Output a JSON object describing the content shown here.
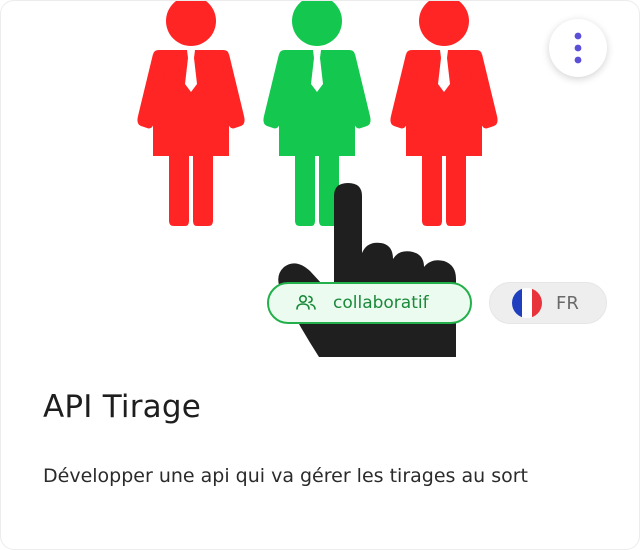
{
  "card": {
    "title": "API Tirage",
    "description": "Développer une api qui va gérer les tirages au sort",
    "menu_icon": "more-vertical-icon",
    "illustration": {
      "icons": [
        "person-icon",
        "person-icon",
        "person-icon",
        "pointing-hand-icon"
      ],
      "colors": {
        "red": "#ff2525",
        "green": "#14c84f",
        "hand": "#1f1f1f"
      }
    },
    "badges": [
      {
        "label": "collaboratif",
        "icon": "users-icon",
        "color": "#22b04b"
      },
      {
        "label": "FR",
        "icon": "france-flag-icon"
      }
    ]
  },
  "colors": {
    "accent": "#5a4fd8",
    "badge_green": "#22b04b",
    "badge_green_bg": "#ecfbf0",
    "badge_grey_bg": "#eeeeee",
    "flag_blue": "#1f3fbf",
    "flag_red": "#e8323c"
  }
}
